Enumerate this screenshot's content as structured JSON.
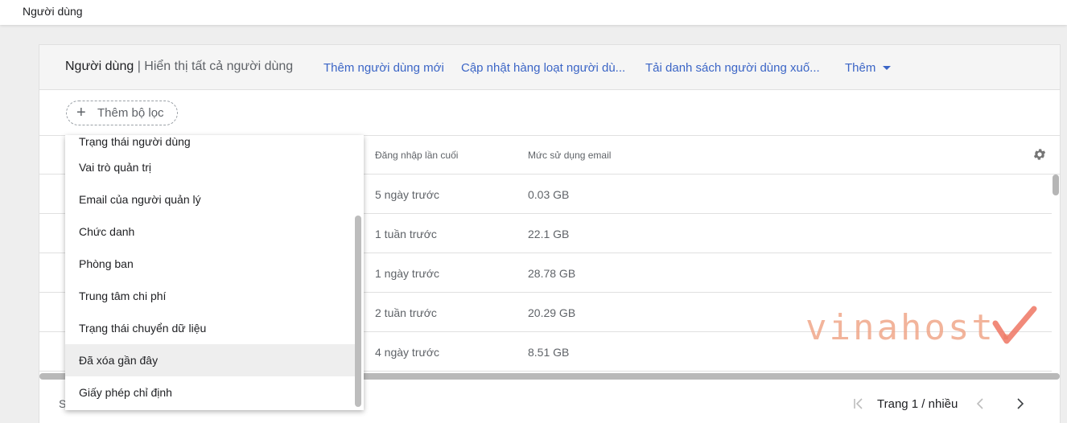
{
  "topbar": {
    "breadcrumb": "Người dùng"
  },
  "header": {
    "title": "Người dùng",
    "separator": " | ",
    "subtitle": "Hiển thị tất cả người dùng",
    "links": {
      "add_user": "Thêm người dùng mới",
      "bulk_update": "Cập nhật hàng loạt người dù...",
      "download": "Tải danh sách người dùng xuố...",
      "more": "Thêm"
    }
  },
  "filter": {
    "plus": "+",
    "label": "Thêm bộ lọc"
  },
  "table": {
    "columns": {
      "last_login": "Đăng nhập lần cuối",
      "email_usage": "Mức sử dụng email"
    },
    "rows": [
      {
        "last_login": "5 ngày trước",
        "email_usage": "0.03 GB"
      },
      {
        "last_login": "1 tuần trước",
        "email_usage": "22.1 GB"
      },
      {
        "last_login": "1 ngày trước",
        "email_usage": "28.78 GB"
      },
      {
        "last_login": "2 tuần trước",
        "email_usage": "20.29 GB"
      },
      {
        "last_login": "4 ngày trước",
        "email_usage": "8.51 GB"
      }
    ]
  },
  "footer": {
    "left_text": "S",
    "page_label": "Trang 1 / nhiều"
  },
  "dropdown": {
    "items": [
      "Trạng thái người dùng",
      "Vai trò quản trị",
      "Email của người quản lý",
      "Chức danh",
      "Phòng ban",
      "Trung tâm chi phí",
      "Trạng thái chuyển dữ liệu",
      "Đã xóa gần đây",
      "Giấy phép chỉ định"
    ],
    "hovered_index": 7
  },
  "watermark": {
    "text": "vinahost."
  },
  "icons": {
    "settings": "gear-icon",
    "first_page": "first-page-icon",
    "prev_page": "chevron-left-icon",
    "next_page": "chevron-right-icon",
    "more_caret": "caret-down-icon",
    "add": "plus-icon"
  },
  "colors": {
    "link": "#3b65c6",
    "header_bg": "#f5f5f5",
    "watermark": "#f0a78a"
  }
}
